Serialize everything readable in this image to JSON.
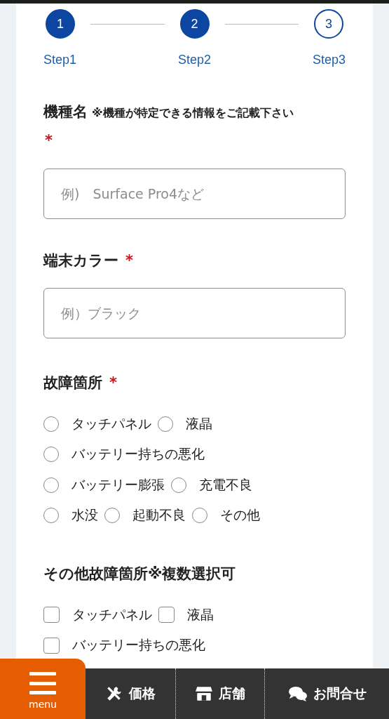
{
  "steps": [
    {
      "number": "1",
      "label": "Step1",
      "completed": true
    },
    {
      "number": "2",
      "label": "Step2",
      "completed": true
    },
    {
      "number": "3",
      "label": "Step3",
      "completed": false
    }
  ],
  "fields": [
    {
      "kind": "text",
      "label": "機種名",
      "note": "※機種が特定できる情報をご記載下さい",
      "required_mark": "*",
      "placeholder": "例)　Surface Pro4など"
    },
    {
      "kind": "text",
      "label": "端末カラー",
      "required_mark": "*",
      "placeholder": "例）ブラック"
    },
    {
      "kind": "radio",
      "label": "故障箇所",
      "required_mark": "*",
      "rows": [
        {
          "options": [
            {
              "label": "タッチパネル",
              "selected": false
            },
            {
              "label": "液晶",
              "selected": false
            }
          ]
        },
        {
          "options": [
            {
              "label": "バッテリー持ちの悪化",
              "selected": false
            }
          ]
        },
        {
          "options": [
            {
              "label": "バッテリー膨張",
              "selected": false
            },
            {
              "label": "充電不良",
              "selected": false
            }
          ]
        },
        {
          "options": [
            {
              "label": "水没",
              "selected": false
            },
            {
              "label": "起動不良",
              "selected": false
            },
            {
              "label": "その他",
              "selected": false
            }
          ]
        }
      ]
    },
    {
      "kind": "checkbox",
      "label": "その他故障箇所※複数選択可",
      "rows": [
        {
          "options": [
            {
              "label": "タッチパネル",
              "checked": false
            },
            {
              "label": "液晶",
              "checked": false
            }
          ]
        },
        {
          "options": [
            {
              "label": "バッテリー持ちの悪化",
              "checked": false
            }
          ]
        }
      ]
    }
  ],
  "bottom_nav": {
    "menu_label": "menu",
    "items": [
      {
        "label": "価格"
      },
      {
        "label": "店舗"
      },
      {
        "label": "お問合せ"
      }
    ]
  }
}
